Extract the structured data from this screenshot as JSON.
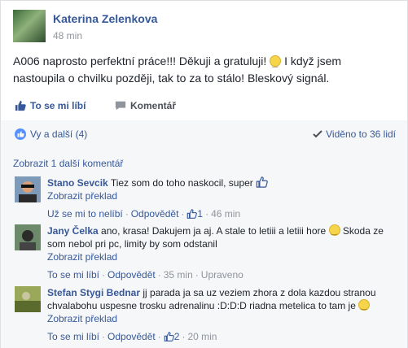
{
  "post": {
    "author": "Katerina Zelenkova",
    "time": "48 min",
    "text_before_smile": "A006 naprosto perfektní práce!!! Děkuji a gratuluji! ",
    "text_after_smile": " I když jsem nastoupila o chvilku později, tak to za to stálo! Bleskový signál.",
    "like_label": "To se mi líbí",
    "comment_label": "Komentář"
  },
  "likes": {
    "summary": "Vy a další (4)",
    "seen_by": "Viděno to 36 lidí"
  },
  "comments_section": {
    "more_comments": "Zobrazit 1 další komentář",
    "items": [
      {
        "name": "Stano Sevcik",
        "text": " Tiez som do toho naskocil, super",
        "translate": "Zobrazit překlad",
        "like_action": "Už se mi to nelíbí",
        "reply": "Odpovědět",
        "like_count": "1",
        "time": "46 min",
        "edited": ""
      },
      {
        "name": "Jany Čelka",
        "text": " ano, krasa! Dakujem ja aj. A stale to letiii a letiii hore ",
        "text_after_smile": " Skoda ze som nebol pri pc, limity by som odstanil",
        "translate": "Zobrazit překlad",
        "like_action": "To se mi líbí",
        "reply": "Odpovědět",
        "like_count": "",
        "time": "35 min",
        "edited": "Upraveno"
      },
      {
        "name": "Stefan Stygi Bednar",
        "text": " jj parada ja sa uz veziem zhora z dola kazdou stranou chvalabohu uspesne trosku adrenalinu :D:D:D riadna metelica to tam je ",
        "translate": "Zobrazit překlad",
        "like_action": "To se mi líbí",
        "reply": "Odpovědět",
        "like_count": "2",
        "time": "20 min",
        "edited": ""
      }
    ]
  },
  "colors": {
    "link_blue": "#365899",
    "meta_gray": "#90949c",
    "panel_bg": "#f6f7f9"
  }
}
